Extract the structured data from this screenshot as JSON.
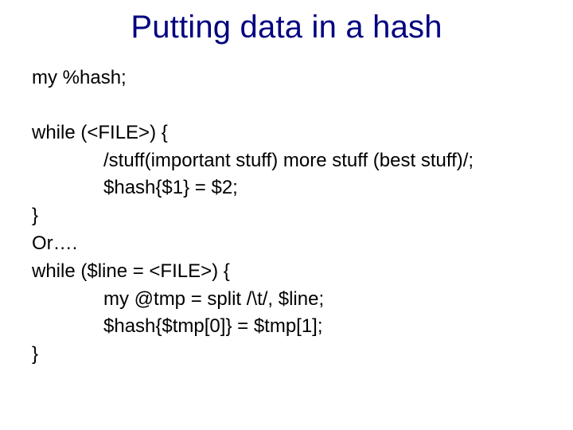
{
  "title": "Putting data in a hash",
  "code": {
    "l0": "my %hash;",
    "l1": "while (<FILE>) {",
    "l2": "/stuff(important stuff) more stuff (best stuff)/;",
    "l3": "$hash{$1} = $2;",
    "l4": "}",
    "l5": "Or….",
    "l6": "while ($line = <FILE>) {",
    "l7": "my @tmp = split /\\t/, $line;",
    "l8": "$hash{$tmp[0]} = $tmp[1];",
    "l9": "}"
  }
}
